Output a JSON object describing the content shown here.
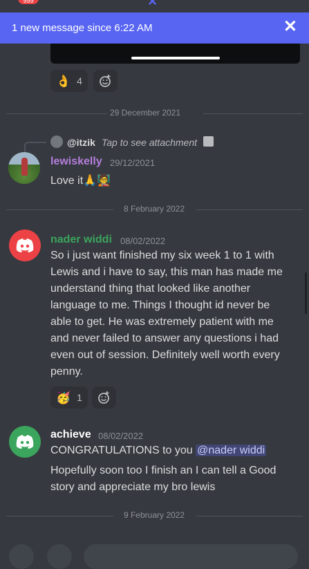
{
  "top_badge": "999",
  "banner": {
    "text": "1 new message since 6:22 AM",
    "close_glyph": "✕"
  },
  "reactions_top": {
    "emoji": "👌",
    "count": "4"
  },
  "dates": {
    "d1": "29 December 2021",
    "d2": "8 February 2022",
    "d3": "9 February 2022"
  },
  "msg_lewis": {
    "reply": {
      "name": "@itzik",
      "text": "Tap to see attachment"
    },
    "username": "lewiskelly",
    "timestamp": "29/12/2021",
    "text": "Love it🙏🧑‍🏫"
  },
  "msg_nader": {
    "username": "nader widdi",
    "timestamp": "08/02/2022",
    "lines": [
      "So i just want finished my six week 1 to 1 with",
      "Lewis and i have to say, this man has made me",
      "understand thing that looked like another",
      "language to me. Things I thought id never be",
      "able to get. He was extremely patient with me",
      "and never failed to answer any questions i had",
      "even out of session. Definitely well worth every",
      "penny."
    ],
    "reaction": {
      "emoji": "🥳",
      "count": "1"
    }
  },
  "msg_achieve": {
    "username": "achieve",
    "timestamp": "08/02/2022",
    "line1_text": "CONGRATULATIONS to you ",
    "mention": "@nader widdi",
    "lines": [
      "Hopefully  soon too I finish an I can tell a Good",
      "story and appreciate  my bro lewis"
    ]
  },
  "colors": {
    "background": "#36393f",
    "banner": "#5865f2",
    "lewis_name": "#b57edc",
    "nader_name": "#3ba55d",
    "achieve_name": "#ffffff"
  }
}
